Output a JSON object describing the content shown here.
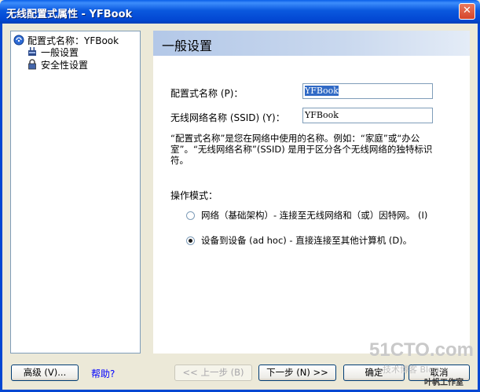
{
  "window": {
    "title": "无线配置式属性 - YFBook",
    "close_glyph": "✕"
  },
  "tree": {
    "root_label": "配置式名称：YFBook",
    "items": [
      {
        "label": "一般设置",
        "selected": true
      },
      {
        "label": "安全性设置",
        "selected": false
      }
    ]
  },
  "main": {
    "header": "一般设置",
    "profile_name": {
      "label": "配置式名称 (P)：",
      "value": "YFBook"
    },
    "ssid": {
      "label": "无线网络名称 (SSID) (Y)：",
      "value": "YFBook"
    },
    "description": "“配置式名称”是您在网络中使用的名称。例如：“家庭”或“办公室”。“无线网络名称”(SSID) 是用于区分各个无线网络的独特标识符。",
    "mode_label": "操作模式：",
    "modes": [
      {
        "label": "网络（基础架构）- 连接至无线网络和（或）因特网。 (I)",
        "checked": false
      },
      {
        "label": "设备到设备 (ad hoc) - 直接连接至其他计算机 (D)。",
        "checked": true
      }
    ]
  },
  "buttons": {
    "advanced": "高级 (V)...",
    "help": "帮助?",
    "back": "<< 上一步 (B)",
    "next": "下一步 (N) >>",
    "ok": "确定",
    "cancel": "取消"
  },
  "watermark": {
    "line1": "51CTO.com",
    "line2": "技术博客 Blog",
    "line3": "叶帆工作室"
  },
  "colors": {
    "title_bar": "#0347D2",
    "dialog_bg": "#ECE9D8",
    "header_band": "#B3C8E8",
    "link": "#0000FF"
  }
}
